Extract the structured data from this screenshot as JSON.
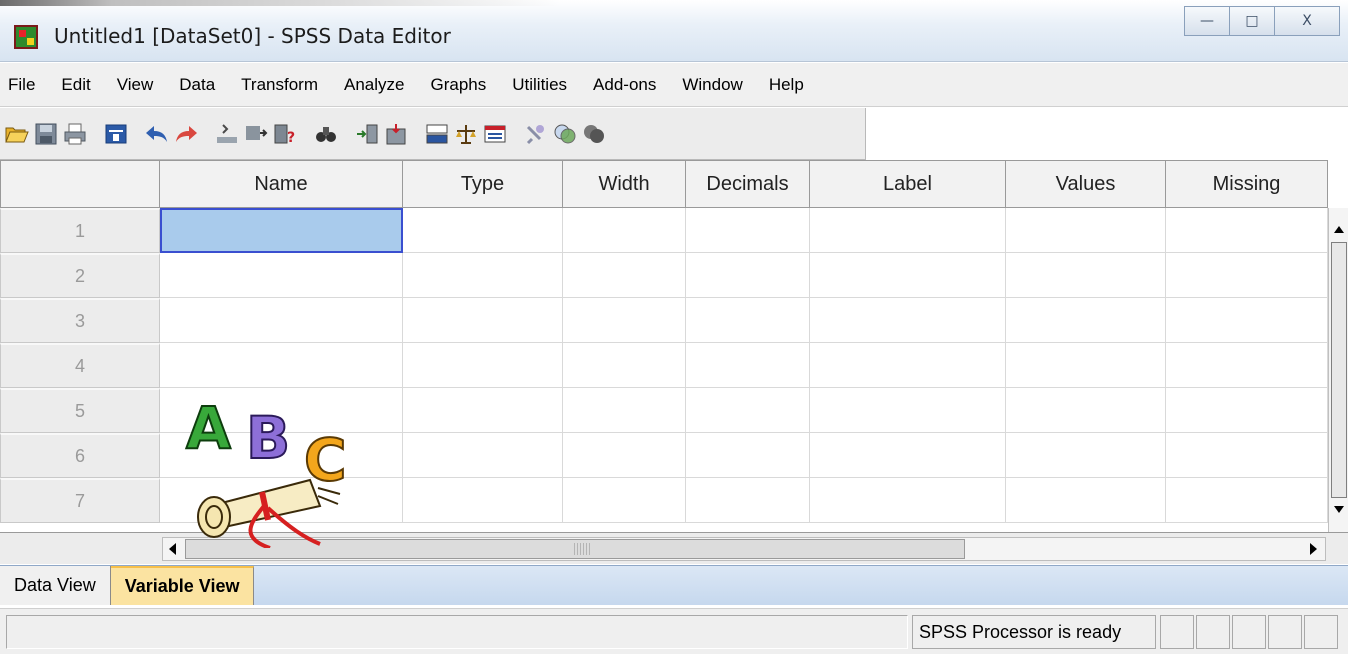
{
  "window": {
    "title": "Untitled1 [DataSet0] - SPSS Data Editor",
    "minimize_label": "—",
    "maximize_label": "□",
    "close_label": "X"
  },
  "menu": [
    "File",
    "Edit",
    "View",
    "Data",
    "Transform",
    "Analyze",
    "Graphs",
    "Utilities",
    "Add-ons",
    "Window",
    "Help"
  ],
  "toolbar_icons": [
    "open-folder-icon",
    "save-icon",
    "print-icon",
    "dialog-recall-icon",
    "undo-icon",
    "redo-icon",
    "goto-case-icon",
    "goto-variable-icon",
    "variables-icon",
    "find-icon",
    "insert-cases-icon",
    "insert-variable-icon",
    "split-file-icon",
    "weight-cases-icon",
    "select-cases-icon",
    "value-labels-icon",
    "use-sets-icon",
    "show-all-variables-icon"
  ],
  "grid": {
    "columns": [
      "Name",
      "Type",
      "Width",
      "Decimals",
      "Label",
      "Values",
      "Missing"
    ],
    "rows": [
      "1",
      "2",
      "3",
      "4",
      "5",
      "6",
      "7"
    ]
  },
  "clipart": {
    "letters": [
      "A",
      "B",
      "C"
    ]
  },
  "tabs": [
    "Data View",
    "Variable View"
  ],
  "status": {
    "text": "SPSS  Processor is ready"
  },
  "colors": {
    "selected_cell": "#a9cbec",
    "active_tab": "#fbe3a1",
    "tab_strip": "#c6d8ee"
  }
}
